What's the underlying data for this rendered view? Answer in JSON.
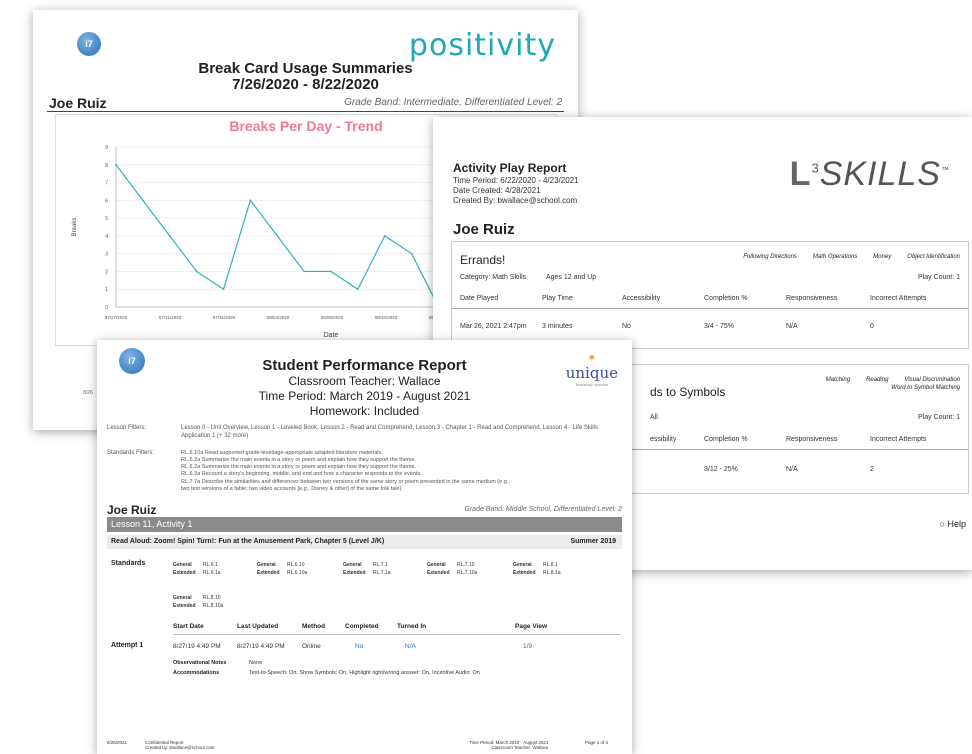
{
  "sheet1": {
    "logo_text": "i7",
    "brand": "positivity",
    "title": "Break Card Usage Summaries",
    "date_range": "7/26/2020 - 8/22/2020",
    "student": "Joe Ruiz",
    "grade_band": "Grade Band: Intermediate, Differentiated Level: 2",
    "footer": "8/26"
  },
  "chart_data": {
    "type": "line",
    "title": "Breaks Per Day - Trend",
    "xlabel": "Date",
    "ylabel": "Breaks",
    "ylim": [
      0,
      9
    ],
    "yticks": [
      0,
      1,
      2,
      3,
      4,
      5,
      6,
      7,
      8,
      9
    ],
    "xtick_labels": [
      "07/27/2020",
      "07/31/2020",
      "07/31/2020",
      "08/04/2020",
      "08/06/2020",
      "08/10/2020",
      "08/12/2020",
      "08/14/2020",
      "08/"
    ],
    "series": [
      {
        "values": [
          8,
          6,
          4,
          2,
          1,
          6,
          4,
          2,
          2,
          1,
          4,
          3,
          0,
          2,
          0,
          4,
          2
        ],
        "color": "#2fb3b7"
      }
    ],
    "grid": true
  },
  "sheet2": {
    "title": "Activity Play Report",
    "time_period": "Time Period: 6/22/2020 - 4/23/2021",
    "date_created": "Date Created: 4/28/2021",
    "created_by": "Created By: bwallace@school.com",
    "brand": "SKILLS",
    "brand_prefix": "L",
    "brand_sup": "3",
    "tm": "™",
    "student": "Joe Ruiz",
    "card1": {
      "activity": "Errands!",
      "tags": [
        "Following Directions",
        "Math Operations",
        "Money",
        "Object Identification"
      ],
      "category": "Category: Math Skills",
      "ages": "Ages 12 and Up",
      "play_count": "Play Count: 1",
      "headers": [
        "Date Played",
        "Play Time",
        "Accessibility",
        "Completion %",
        "Responsiveness",
        "Incorrect Attempts"
      ],
      "row": [
        "Mar 26, 2021 2:47pm",
        "3 minutes",
        "No",
        "3/4 - 75%",
        "N/A",
        "0"
      ]
    },
    "card2": {
      "activity": "ds to Symbols",
      "tags": [
        "Matching",
        "Reading",
        "Visual Discrimination"
      ],
      "tag2": "Word to Symbol Matching",
      "all": "All",
      "play_count": "Play Count: 1",
      "headers": [
        "essibility",
        "Completion %",
        "Responsiveness",
        "Incorrect Attempts"
      ],
      "row": [
        "3/12 - 25%",
        "N/A",
        "2"
      ]
    },
    "help": "Help"
  },
  "sheet3": {
    "logo_text": "i7",
    "brand": "unique",
    "brand_sub": "learning system",
    "title": "Student Performance Report",
    "teacher": "Classroom Teacher: Wallace",
    "period": "Time Period: March 2019 - August 2021",
    "homework": "Homework: Included",
    "lesson_filters_label": "Lesson Filters:",
    "lesson_filters": "Lesson 0 - Unit Overview, Lesson 1 - Leveled Book, Lesson 2 - Read and Comprehend, Lesson 3 - Chapter 1 - Read and Comprehend, Lesson 4 - Life Skills Application 1 (+ 32 more)",
    "standards_filters_label": "Standards Filters:",
    "standards_filters": [
      "RL.6.10a Read supported grade-level/age-appropriate adapted literature materials.",
      "RL.6.2a Summarize the main events in a story or poem and explain how they support the theme.",
      "RL.6.2a Summarize the main events in a story or poem and explain how they support the theme.",
      "RL.6.3a Recount a story's beginning, middle, and end and how a character responds to the events.",
      "RL.7.7a Describe the similarities and differences between two versions of the same story or poem presented in the same medium (e.g.,",
      "two text versions of a fable; two video accounts [e.g., Disney & other] of the same folk tale)"
    ],
    "student": "Joe Ruiz",
    "grade_band": "Grade Band: Middle School, Differentiated Level: 2",
    "lesson": "Lesson 11, Activity 1",
    "read_aloud": "Read Aloud: Zoom! Spin! Turn!: Fun at the Amusement Park, Chapter 5 (Level J/K)",
    "season": "Summer 2019",
    "standards_label": "Standards",
    "standards": [
      {
        "g": "General",
        "gv": "RL.6.1",
        "e": "Extended",
        "ev": "RL.6.1a"
      },
      {
        "g": "General",
        "gv": "RL.6.10",
        "e": "Extended",
        "ev": "RL.6.10a"
      },
      {
        "g": "General",
        "gv": "RL.7.1",
        "e": "Extended",
        "ev": "RL.7.1a"
      },
      {
        "g": "General",
        "gv": "RL.7.10",
        "e": "Extended",
        "ev": "RL.7.10a"
      },
      {
        "g": "General",
        "gv": "RL.8.1",
        "e": "Extended",
        "ev": "RL.8.1a"
      },
      {
        "g": "General",
        "gv": "RL.8.10",
        "e": "Extended",
        "ev": "RL.8.10a"
      }
    ],
    "attempt_headers": [
      "Start Date",
      "Last Updated",
      "Method",
      "Completed",
      "Turned In",
      "Page View"
    ],
    "attempt_label": "Attempt 1",
    "attempt_row": [
      "8/27/19 4:49 PM",
      "8/27/19 4:49 PM",
      "Online",
      "No",
      "N/A",
      "1/9"
    ],
    "obs_label": "Observational Notes",
    "obs_value": "None",
    "acc_label": "Accommodations",
    "acc_value": "Text-to-Speech: On, Show Symbols: On, Highlight right/wrong answer: On, Incentive Audio: On",
    "footer_date": "8/26/2021",
    "footer_conf": "Confidential Report",
    "footer_by": "Created by: bwallace@school.com",
    "footer_period": "Time Period: March 2019 - August 2021",
    "footer_teacher": "Classroom Teacher: Wallace",
    "footer_page": "Page 1 of 4"
  }
}
